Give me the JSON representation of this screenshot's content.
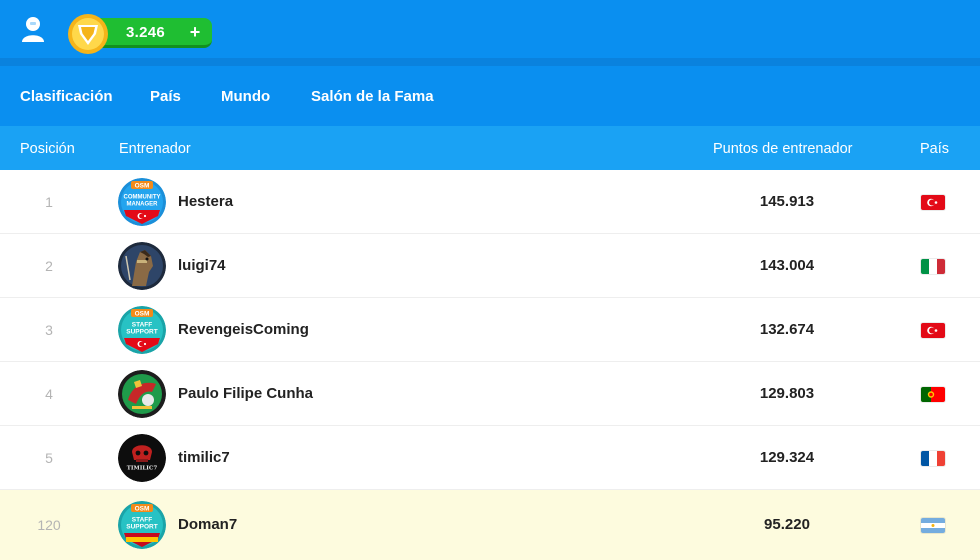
{
  "header": {
    "coins": "3.246",
    "coins_plus": "+"
  },
  "tabs": [
    {
      "label": "Clasificación",
      "active": true
    },
    {
      "label": "País"
    },
    {
      "label": "Mundo"
    },
    {
      "label": "Salón de la Fama"
    }
  ],
  "columns": {
    "position": "Posición",
    "manager": "Entrenador",
    "points": "Puntos de entrenador",
    "country": "País"
  },
  "rows": [
    {
      "position": "1",
      "name": "Hestera",
      "points": "145.913",
      "flag": "turkey",
      "avatar": "osm-community-manager-badge",
      "badge_top": "OSM",
      "badge_line1": "COMMUNITY",
      "badge_line2": "MANAGER"
    },
    {
      "position": "2",
      "name": "luigi74",
      "points": "143.004",
      "flag": "italy",
      "avatar": "horse-avatar"
    },
    {
      "position": "3",
      "name": "RevengeisComing",
      "points": "132.674",
      "flag": "turkey",
      "avatar": "osm-staff-support-badge",
      "badge_top": "OSM",
      "badge_line1": "STAFF",
      "badge_line2": "SUPPORT"
    },
    {
      "position": "4",
      "name": "Paulo Filipe Cunha",
      "points": "129.803",
      "flag": "portugal",
      "avatar": "club-crest-avatar"
    },
    {
      "position": "5",
      "name": "timilic7",
      "points": "129.324",
      "flag": "france",
      "avatar": "timilic-avatar",
      "avatar_text": "TIMILIC7"
    },
    {
      "position": "120",
      "name": "Doman7",
      "points": "95.220",
      "flag": "argentina",
      "avatar": "osm-staff-support-badge",
      "badge_top": "OSM",
      "badge_line1": "STAFF",
      "badge_line2": "SUPPORT",
      "highlight": true
    }
  ],
  "colors": {
    "header_blue": "#0a8ff0",
    "column_header_blue": "#1aa2f4",
    "coin_green": "#1fbe32",
    "highlight_row": "#fdfbde"
  }
}
